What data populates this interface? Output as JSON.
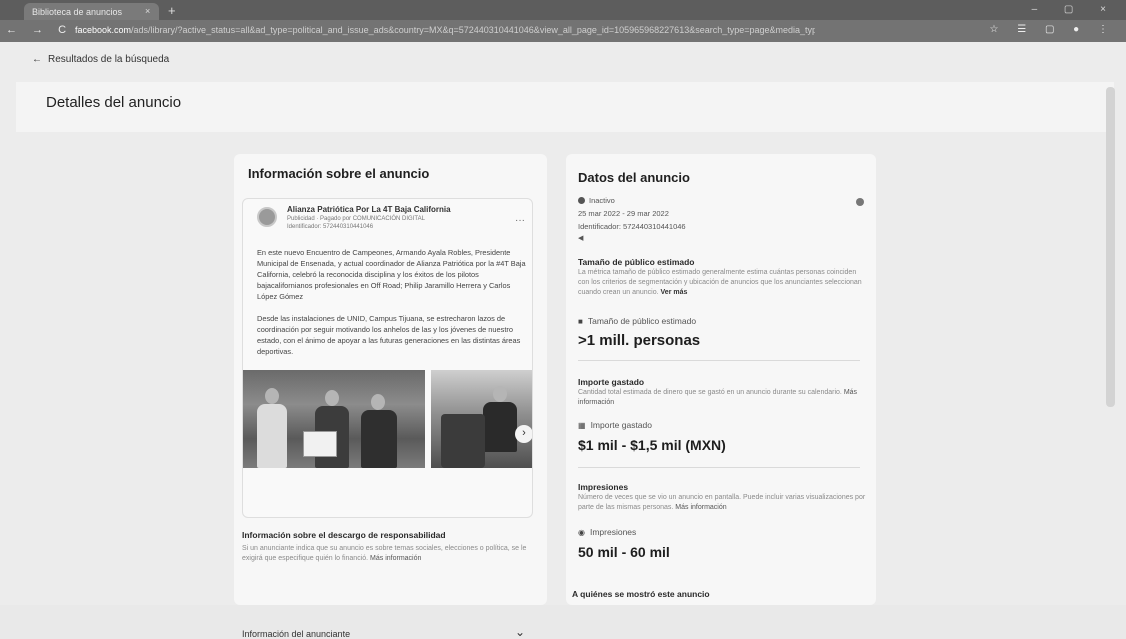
{
  "browser": {
    "tab_title": "Biblioteca de anuncios",
    "tab_close": "×",
    "new_tab": "+",
    "window_controls": "–  ▢  ×",
    "nav": "←  →  C",
    "url_host": "facebook.com",
    "url_path": "/ads/library/?active_status=all&ad_type=political_and_issue_ads&country=MX&q=572440310441046&view_all_page_id=105965968227613&search_type=page&media_type=all",
    "toolbar_icons": "☆  ☰  ▢  ●  ⋮"
  },
  "nav": {
    "back_arrow": "←",
    "back_label": "Resultados de la búsqueda"
  },
  "page_title": "Detalles del anuncio",
  "ad_info": {
    "title": "Información sobre el anuncio",
    "page_name": "Alianza Patriótica Por La 4T Baja California",
    "sponsor_line": "Publicidad · Pagado por COMUNICACIÓN DIGITAL",
    "id_line": "Identificador: 572440310441046",
    "more": "···",
    "text_p1": "En este nuevo Encuentro de Campeones, Armando Ayala Robles, Presidente Municipal de Ensenada, y actual coordinador de Alianza Patriótica por la #4T Baja California, celebró la reconocida disciplina y los éxitos de los pilotos bajacalifornianos profesionales en Off Road; Philip Jaramillo Herrera y Carlos López Gómez",
    "text_p2": "Desde las instalaciones de UNID, Campus Tijuana, se estrecharon lazos de coordinación por seguir motivando los anhelos de las y los jóvenes de nuestro estado, con el ánimo de apoyar a las futuras generaciones en las distintas áreas deportivas.",
    "carousel_next": "›",
    "disclaimer_title": "Información sobre el descargo de responsabilidad",
    "disclaimer_text": "Si un anunciante indica que su anuncio es sobre temas sociales, elecciones o política, se le exigirá que especifique quién lo financió.",
    "disclaimer_link": "Más información",
    "advertiser_info": "Información del anunciante",
    "chevron": "⌄"
  },
  "ad_data": {
    "title": "Datos del anuncio",
    "status": "Inactivo",
    "dates": "25 mar 2022 - 29 mar 2022",
    "identifier": "Identificador: 572440310441046",
    "platform_icon": "◀",
    "audience_title": "Tamaño de público estimado",
    "audience_desc": "La métrica tamaño de público estimado generalmente estima cuántas personas coinciden con los criterios de segmentación y ubicación de anuncios que los anunciantes seleccionan cuando crean un anuncio.",
    "audience_link": "Ver más",
    "audience_label": "Tamaño de público estimado",
    "audience_value": ">1 mill. personas",
    "spend_title": "Importe gastado",
    "spend_desc": "Cantidad total estimada de dinero que se gastó en un anuncio durante su calendario.",
    "spend_link": "Más información",
    "spend_label": "Importe gastado",
    "spend_value": "$1 mil - $1,5 mil (MXN)",
    "impressions_title": "Impresiones",
    "impressions_desc": "Número de veces que se vio un anuncio en pantalla. Puede incluir varias visualizaciones por parte de las mismas personas.",
    "impressions_link": "Más información",
    "impressions_label": "Impresiones",
    "impressions_value": "50 mil - 60 mil",
    "shown_to_title": "A quiénes se mostró este anuncio"
  }
}
